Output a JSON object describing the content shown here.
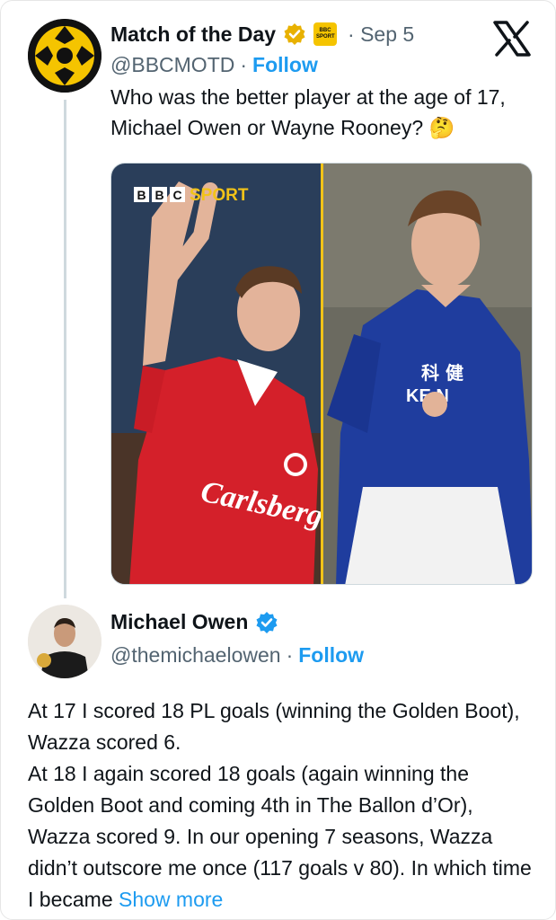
{
  "tweet": {
    "display_name": "Match of the Day",
    "handle": "@BBCMOTD",
    "follow_label": "Follow",
    "separator": "·",
    "date": "Sep 5",
    "text": "Who was the better player at the age of 17, Michael Owen or Wayne Rooney? 🤔",
    "media": {
      "brand_boxes": [
        "B",
        "B",
        "C"
      ],
      "brand_word": "SPORT",
      "divider_color": "#f2c318"
    },
    "badge_text": "BBC SPORT"
  },
  "reply": {
    "display_name": "Michael Owen",
    "handle": "@themichaelowen",
    "follow_label": "Follow",
    "separator": "·",
    "paragraphs": [
      "At 17 I scored 18 PL goals (winning the Golden Boot), Wazza scored 6.",
      "At 18 I again scored 18 goals (again winning the Golden Boot and coming 4th in The Ballon d’Or), Wazza scored 9. In our opening 7 seasons, Wazza didn’t outscore me once (117 goals v 80). In which time I became"
    ],
    "show_more_label": "Show more"
  },
  "colors": {
    "accent": "#1d9bf0",
    "secondary_text": "#536471",
    "verified_gold": "#e8b100",
    "verified_blue": "#1d9bf0"
  },
  "icons": [
    "x-logo-icon",
    "verified-gold-icon",
    "verified-blue-icon",
    "bbc-sport-badge-icon"
  ]
}
